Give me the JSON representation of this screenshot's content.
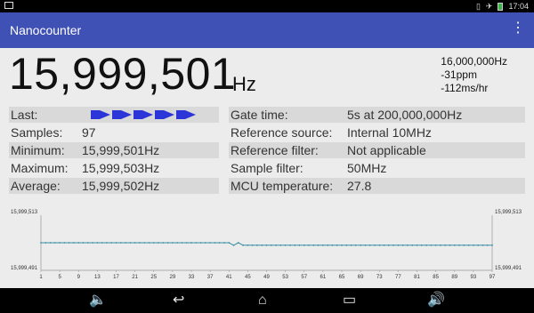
{
  "status_bar": {
    "time": "17:04"
  },
  "app": {
    "title": "Nanocounter",
    "menu_icon": "more-vert-icon"
  },
  "reading": {
    "frequency": "15,999,501",
    "unit": "Hz",
    "reference": "16,000,000Hz",
    "ppm": "-31ppm",
    "drift": "-112ms/hr"
  },
  "stats": {
    "last_label": "Last:",
    "samples_label": "Samples:",
    "samples_value": "97",
    "minimum_label": "Minimum:",
    "minimum_value": "15,999,501Hz",
    "maximum_label": "Maximum:",
    "maximum_value": "15,999,503Hz",
    "average_label": "Average:",
    "average_value": "15,999,502Hz"
  },
  "settings": {
    "gate_label": "Gate time:",
    "gate_value": "5s at 200,000,000Hz",
    "refsrc_label": "Reference source:",
    "refsrc_value": "Internal 10MHz",
    "reffilter_label": "Reference filter:",
    "reffilter_value": "Not applicable",
    "samplefilter_label": "Sample filter:",
    "samplefilter_value": "50MHz",
    "mcu_label": "MCU temperature:",
    "mcu_value": "27.8"
  },
  "chart_data": {
    "type": "line",
    "y_top_label": "15,999,513",
    "y_bottom_label": "15,999,491",
    "ylim": [
      15999491,
      15999513
    ],
    "x_ticks": [
      "1",
      "5",
      "9",
      "13",
      "17",
      "21",
      "25",
      "29",
      "33",
      "37",
      "41",
      "45",
      "49",
      "53",
      "57",
      "61",
      "65",
      "69",
      "73",
      "77",
      "81",
      "85",
      "89",
      "93",
      "97"
    ],
    "color": "#3a8fa3",
    "series": [
      {
        "x_start": 1,
        "x_end": 97,
        "values": [
          15999502,
          15999502,
          15999502,
          15999502,
          15999502,
          15999502,
          15999502,
          15999502,
          15999502,
          15999502,
          15999502,
          15999502,
          15999502,
          15999502,
          15999502,
          15999502,
          15999502,
          15999502,
          15999502,
          15999502,
          15999502,
          15999502,
          15999502,
          15999502,
          15999502,
          15999502,
          15999502,
          15999502,
          15999502,
          15999502,
          15999502,
          15999502,
          15999502,
          15999502,
          15999502,
          15999502,
          15999502,
          15999502,
          15999502,
          15999502,
          15999502,
          15999501,
          15999502,
          15999501,
          15999501,
          15999501,
          15999501,
          15999501,
          15999501,
          15999501,
          15999501,
          15999501,
          15999501,
          15999501,
          15999501,
          15999501,
          15999501,
          15999501,
          15999501,
          15999501,
          15999501,
          15999501,
          15999501,
          15999501,
          15999501,
          15999501,
          15999501,
          15999501,
          15999501,
          15999501,
          15999501,
          15999501,
          15999501,
          15999501,
          15999501,
          15999501,
          15999501,
          15999501,
          15999501,
          15999501,
          15999501,
          15999501,
          15999501,
          15999501,
          15999501,
          15999501,
          15999501,
          15999501,
          15999501,
          15999501,
          15999501,
          15999501,
          15999501,
          15999501,
          15999501,
          15999501,
          15999501
        ]
      }
    ]
  },
  "nav": {
    "volume_down_icon": "volume-down-icon",
    "back_icon": "back-icon",
    "home_icon": "home-icon",
    "recents_icon": "recents-icon",
    "volume_up_icon": "volume-up-icon"
  }
}
